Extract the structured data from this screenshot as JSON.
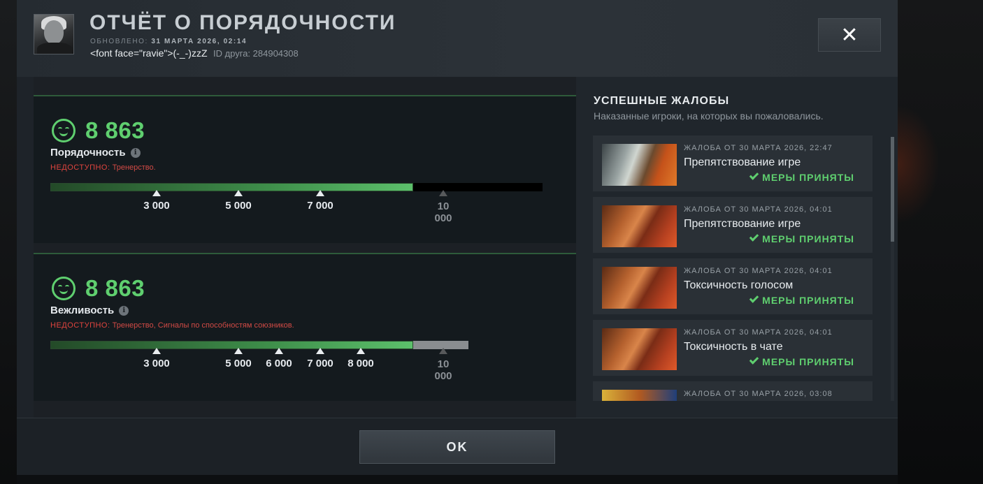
{
  "header": {
    "title": "ОТЧЁТ О ПОРЯДОЧНОСТИ",
    "updated_label": "ОБНОВЛЕНО:",
    "updated_value": "31 МАРТА 2026, 02:14",
    "player_name": "<font face=\"ravie\">(-_-)zzZ",
    "friend_id": "ID друга: 284904308"
  },
  "conduct": {
    "score": "8 863",
    "label": "Порядочность",
    "unavailable_label": "НЕДОСТУПНО:",
    "unavailable_text": "Тренерство.",
    "progress": 0.7377,
    "ticks": [
      "3 000",
      "5 000",
      "7 000"
    ],
    "max_tick": "10 000"
  },
  "politeness": {
    "score": "8 863",
    "label": "Вежливость",
    "unavailable_label": "НЕДОСТУПНО:",
    "unavailable_text": "Тренерство, Сигналы по способностям союзников.",
    "progress": 0.7377,
    "ticks": [
      "3 000",
      "5 000",
      "6 000",
      "7 000",
      "8 000"
    ],
    "max_tick": "10 000"
  },
  "reports": {
    "title": "УСПЕШНЫЕ ЖАЛОБЫ",
    "subtitle": "Наказанные игроки, на которых вы пожаловались.",
    "items": [
      {
        "date": "ЖАЛОБА ОТ 30 МАРТА 2026, 22:47",
        "reason": "Препятствование игре",
        "status": "МЕРЫ ПРИНЯТЫ"
      },
      {
        "date": "ЖАЛОБА ОТ 30 МАРТА 2026, 04:01",
        "reason": "Препятствование игре",
        "status": "МЕРЫ ПРИНЯТЫ"
      },
      {
        "date": "ЖАЛОБА ОТ 30 МАРТА 2026, 04:01",
        "reason": "Токсичность голосом",
        "status": "МЕРЫ ПРИНЯТЫ"
      },
      {
        "date": "ЖАЛОБА ОТ 30 МАРТА 2026, 04:01",
        "reason": "Токсичность в чате",
        "status": "МЕРЫ ПРИНЯТЫ"
      },
      {
        "date": "ЖАЛОБА ОТ 30 МАРТА 2026, 03:08"
      }
    ]
  },
  "footer": {
    "ok_label": "OK",
    "close_label": "✕"
  },
  "colors": {
    "accent_green": "#5fcf6f",
    "warning_red": "#e0443e",
    "panel_bg": "#1e2329"
  }
}
